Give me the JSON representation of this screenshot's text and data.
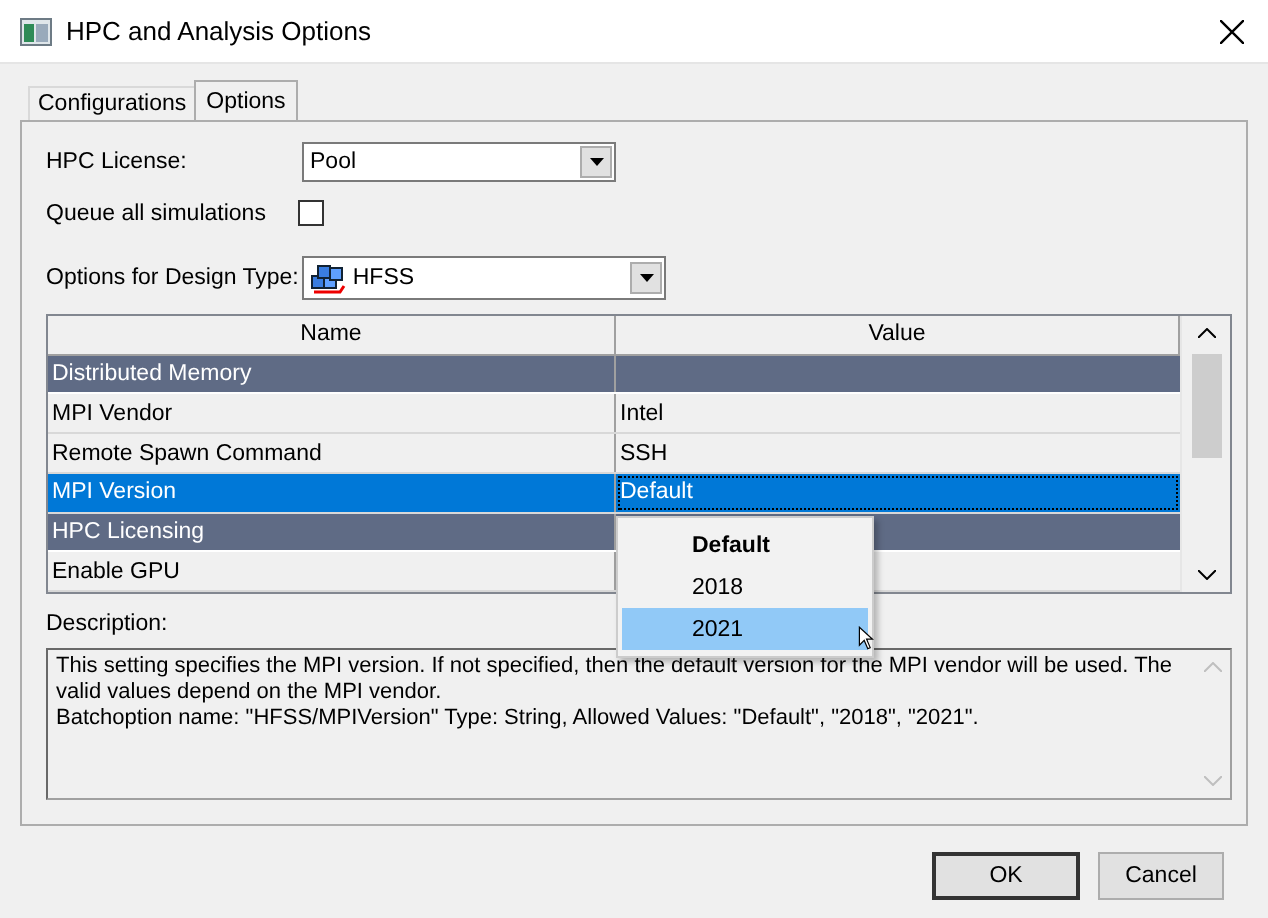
{
  "window": {
    "title": "HPC and Analysis Options"
  },
  "tabs": [
    {
      "label": "Configurations",
      "selected": false
    },
    {
      "label": "Options",
      "selected": true
    }
  ],
  "hpc_license": {
    "label": "HPC License:",
    "value": "Pool"
  },
  "queue_all": {
    "label": "Queue all simulations",
    "checked": false
  },
  "design_type": {
    "label": "Options for Design Type:",
    "value": "HFSS"
  },
  "grid": {
    "columns": [
      "Name",
      "Value"
    ],
    "rows": [
      {
        "kind": "category",
        "name": "Distributed Memory",
        "selected": false
      },
      {
        "kind": "property",
        "name": "MPI Vendor",
        "value": "Intel",
        "selected": false
      },
      {
        "kind": "property",
        "name": "Remote Spawn Command",
        "value": "SSH",
        "selected": false
      },
      {
        "kind": "property",
        "name": "MPI Version",
        "value": "Default",
        "selected": true
      },
      {
        "kind": "category",
        "name": "HPC Licensing",
        "selected": false
      },
      {
        "kind": "property",
        "name": "Enable GPU",
        "selected": false
      }
    ]
  },
  "dropdown": {
    "options": [
      {
        "label": "Default",
        "current": true,
        "selected": false
      },
      {
        "label": "2018",
        "current": false,
        "selected": false
      },
      {
        "label": "2021",
        "current": false,
        "selected": true
      }
    ]
  },
  "description": {
    "label": "Description:",
    "text": "This setting specifies the MPI version. If not specified, then the default version for the MPI vendor will be used. The valid values depend on the MPI vendor.\nBatchoption name: \"HFSS/MPIVersion\" Type: String, Allowed Values: \"Default\", \"2018\", \"2021\"."
  },
  "buttons": [
    {
      "label": "OK",
      "default": true
    },
    {
      "label": "Cancel",
      "default": false
    }
  ]
}
